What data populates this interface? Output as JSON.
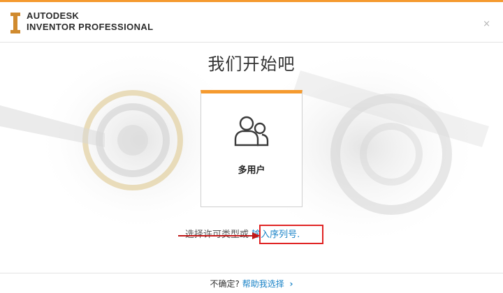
{
  "header": {
    "brand_line1": "AUTODESK",
    "brand_line2": "INVENTOR PROFESSIONAL",
    "close_glyph": "×",
    "accent_color": "#f59a2f"
  },
  "main": {
    "title": "我们开始吧",
    "card": {
      "label": "多用户",
      "icon": "users-icon"
    },
    "license_prompt": "选择许可类型或",
    "license_link": "输入序列号."
  },
  "footer": {
    "question": "不确定?",
    "help_link": "帮助我选择",
    "chevron": "›"
  },
  "colors": {
    "link": "#1a83c7",
    "highlight": "#e02424"
  }
}
